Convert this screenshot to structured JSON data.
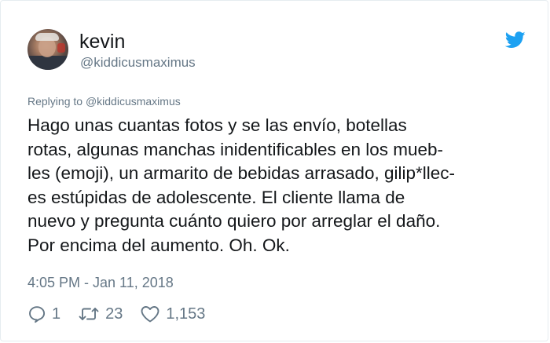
{
  "user": {
    "name": "kevin",
    "handle": "@kiddicusmaximus"
  },
  "replying": {
    "prefix": "Replying to",
    "target": "@kiddicusmaximus"
  },
  "tweet": {
    "text": "Hago unas cuantas fotos y se las envío, botellas\nrotas, algunas manchas inidentificables en los mueb-\nles (emoji), un armarito de bebidas arrasado, gilip*llec-\nes estúpidas de adolescente. El cliente llama de\nnuevo y pregunta cuánto quiero por arreglar el daño.\nPor encima del aumento. Oh. Ok.",
    "timestamp": "4:05 PM - Jan 11, 2018"
  },
  "actions": {
    "replies": "1",
    "retweets": "23",
    "likes": "1,153"
  },
  "icons": {
    "brand": "twitter-bird-icon",
    "reply": "reply-bubble-icon",
    "retweet": "retweet-icon",
    "like": "heart-icon"
  },
  "colors": {
    "twitter_blue": "#1da1f2",
    "secondary_text": "#657786",
    "primary_text": "#14171a"
  }
}
